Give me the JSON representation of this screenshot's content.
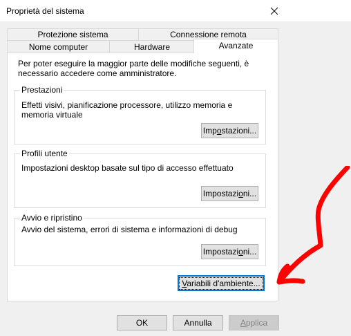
{
  "window": {
    "title": "Proprietà del sistema",
    "close_icon": "close-icon"
  },
  "tabs": {
    "row1": [
      {
        "label": "Protezione sistema"
      },
      {
        "label": "Connessione remota"
      }
    ],
    "row2": [
      {
        "label": "Nome computer"
      },
      {
        "label": "Hardware"
      },
      {
        "label": "Avanzate",
        "active": true
      }
    ]
  },
  "panel": {
    "note": "Per poter eseguire la maggior parte delle modifiche seguenti, è necessario accedere come amministratore.",
    "groups": [
      {
        "label": "Prestazioni",
        "description": "Effetti visivi, pianificazione processore, utilizzo memoria e memoria virtuale",
        "button_pre": "Imp",
        "button_u": "o",
        "button_post": "stazioni..."
      },
      {
        "label": "Profili utente",
        "description": "Impostazioni desktop basate sul tipo di accesso effettuato",
        "button_pre": "Impostazi",
        "button_u": "o",
        "button_post": "ni..."
      },
      {
        "label": "Avvio e ripristino",
        "description": "Avvio del sistema, errori di sistema e informazioni di debug",
        "button_pre": "Impostazi",
        "button_u": "o",
        "button_post": "ni..."
      }
    ],
    "env_button_pre": "",
    "env_button_u": "V",
    "env_button_post": "ariabili d'ambiente..."
  },
  "footer": {
    "ok": "OK",
    "cancel": "Annulla",
    "apply_pre": "",
    "apply_u": "A",
    "apply_post": "pplica"
  },
  "colors": {
    "annotation": "#ff0000",
    "focus": "#0078d7"
  }
}
